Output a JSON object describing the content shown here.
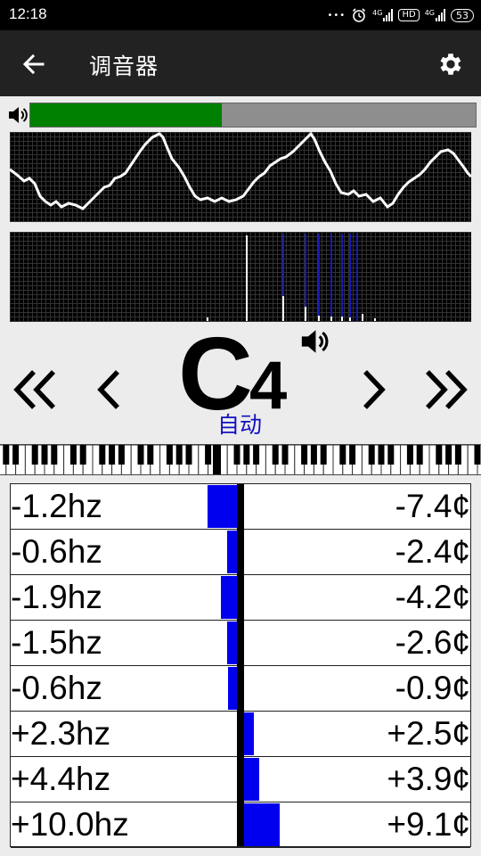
{
  "status_bar": {
    "time": "12:18",
    "network_1": "4G",
    "network_2": "4G",
    "hd_badge": "HD",
    "battery": "53"
  },
  "app_bar": {
    "title": "调音器"
  },
  "volume": {
    "level_fraction": 0.43,
    "fill_color": "#008000"
  },
  "note": {
    "letter": "C",
    "octave": "4",
    "mode": "自动"
  },
  "readings": [
    {
      "hz": "-1.2hz",
      "cents": "-7.4¢",
      "deviation": -7.4
    },
    {
      "hz": "-0.6hz",
      "cents": "-2.4¢",
      "deviation": -2.4
    },
    {
      "hz": "-1.9hz",
      "cents": "-4.2¢",
      "deviation": -4.2
    },
    {
      "hz": "-1.5hz",
      "cents": "-2.6¢",
      "deviation": -2.6
    },
    {
      "hz": "-0.6hz",
      "cents": "-0.9¢",
      "deviation": -0.9
    },
    {
      "hz": "+2.3hz",
      "cents": "+2.5¢",
      "deviation": 2.5
    },
    {
      "hz": "+4.4hz",
      "cents": "+3.9¢",
      "deviation": 3.9
    },
    {
      "hz": "+10.0hz",
      "cents": "+9.1¢",
      "deviation": 9.1
    }
  ]
}
